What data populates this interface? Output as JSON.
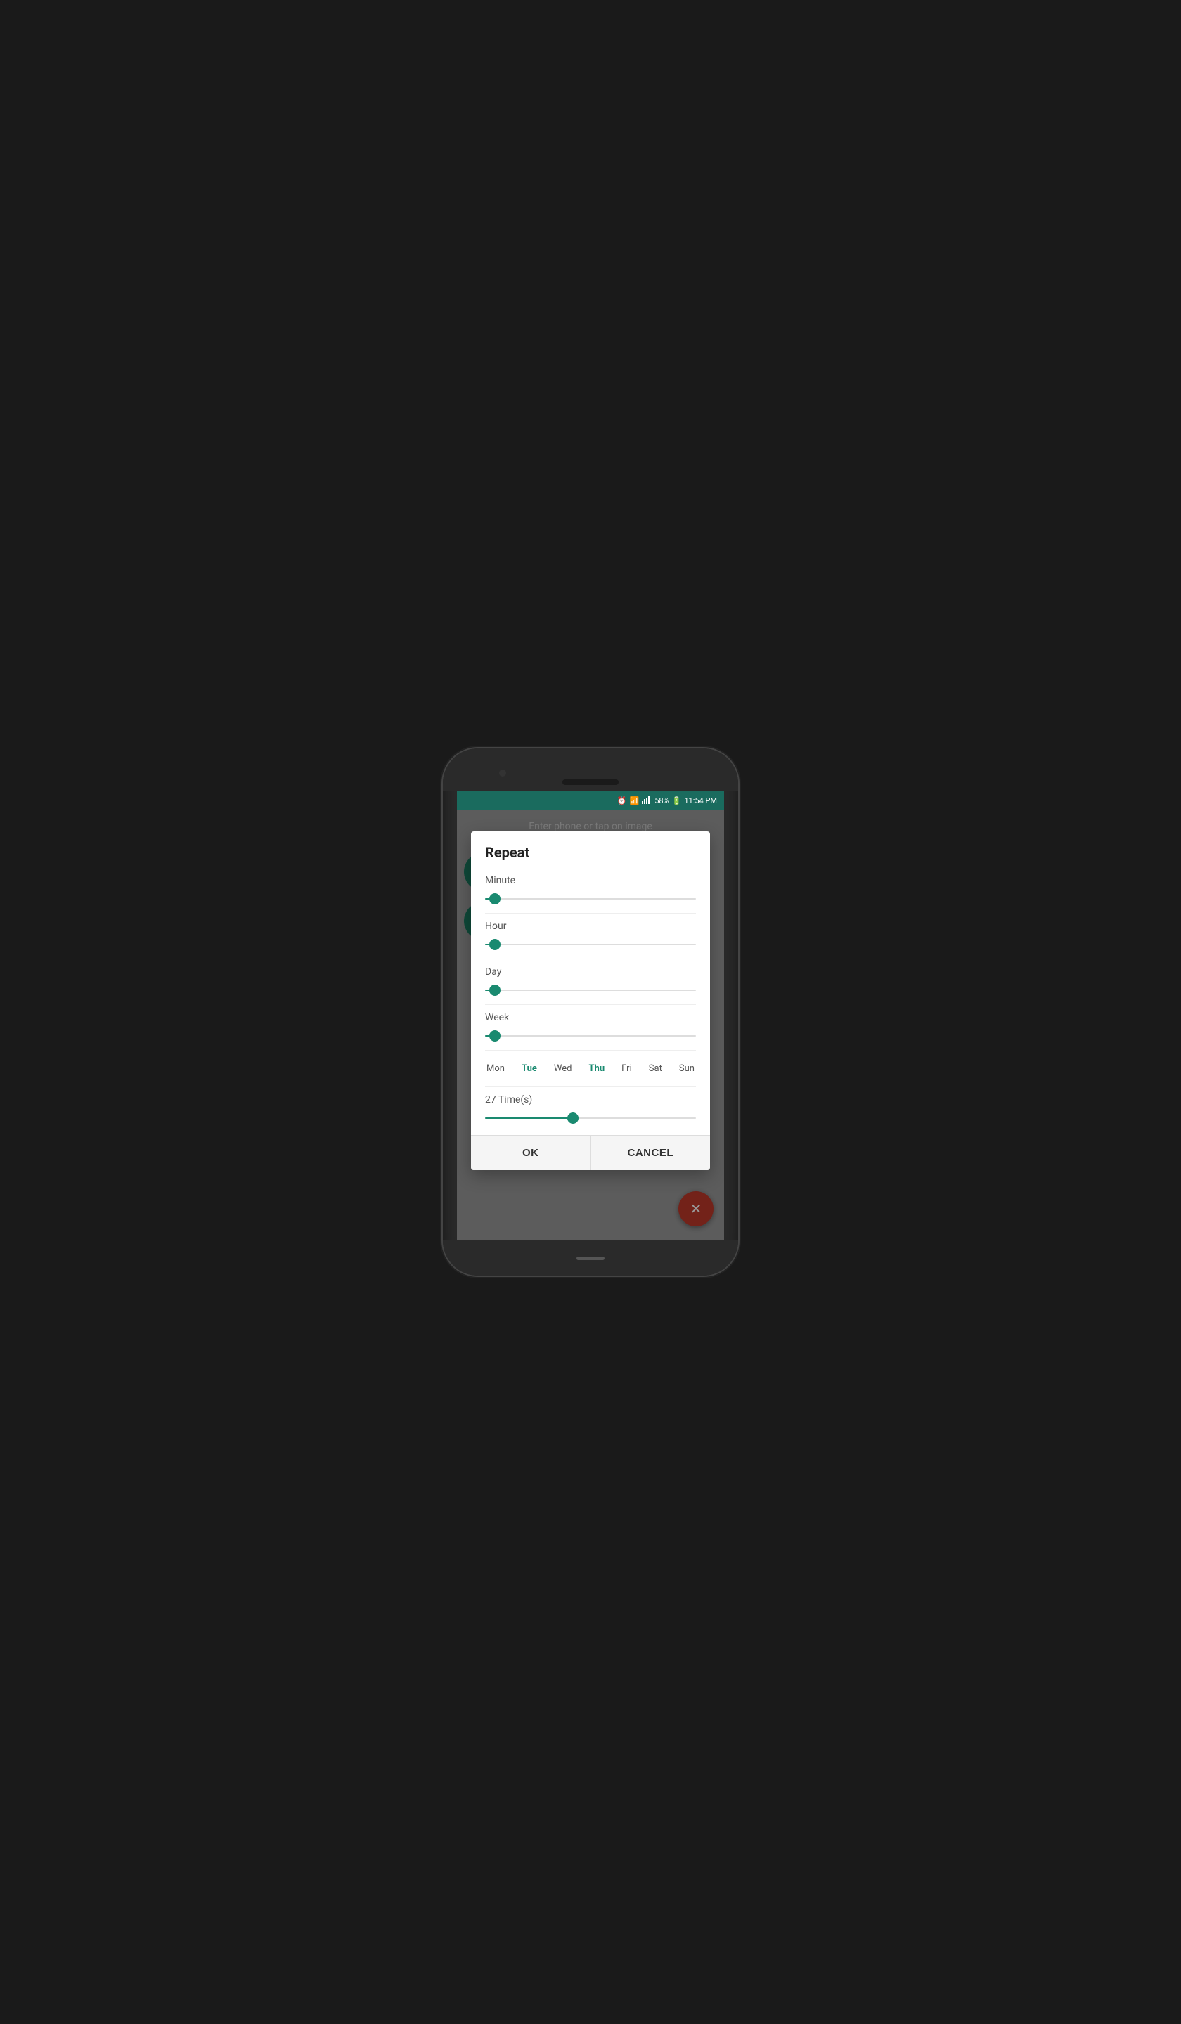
{
  "status_bar": {
    "time": "11:54 PM",
    "battery": "58%",
    "bg_color": "#1a6b5e"
  },
  "background": {
    "text": "Enter phone or tap on image"
  },
  "dialog": {
    "title": "Repeat",
    "sliders": [
      {
        "label": "Minute",
        "value": 5,
        "percent": 5
      },
      {
        "label": "Hour",
        "value": 5,
        "percent": 5
      },
      {
        "label": "Day",
        "value": 5,
        "percent": 5
      },
      {
        "label": "Week",
        "value": 5,
        "percent": 5
      }
    ],
    "days": [
      {
        "label": "Mon",
        "active": false
      },
      {
        "label": "Tue",
        "active": true
      },
      {
        "label": "Wed",
        "active": false
      },
      {
        "label": "Thu",
        "active": true
      },
      {
        "label": "Fri",
        "active": false
      },
      {
        "label": "Sat",
        "active": false
      },
      {
        "label": "Sun",
        "active": false
      }
    ],
    "times_label": "27 Time(s)",
    "times_percent": 42,
    "btn_ok": "OK",
    "btn_cancel": "CANCEL"
  }
}
